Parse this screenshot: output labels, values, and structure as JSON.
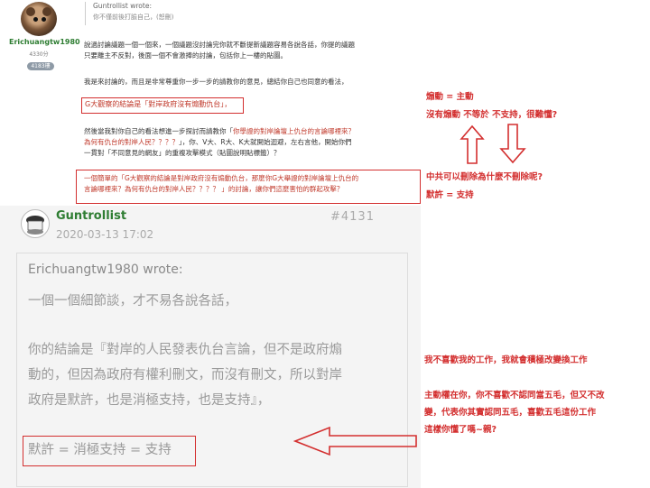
{
  "top_post": {
    "author": "Erichuangtw1980",
    "points": "4330分",
    "badge": "4183樓",
    "quote_author": "Guntrollist wrote:",
    "quote_text": "你不僅前後打臉自己，(恕刪)",
    "para1_line1": "說過討論議題一個一個來，一個議題沒討論完你就不斷提新議題容易各說各話，你提的議題",
    "para1_line2": "只要離主不反對，後面一個不會激捧的討論，包括你上一樓的貼圖。",
    "para2": "我是來討論的，而且是非常尊重你一步一步的請教你的意見，總結你自己也同意的看法，",
    "conclusion": "G大觀察的結論是「對岸政府沒有煽動仇台」，",
    "para3_line1_a": "然後當我對你自己的看法想進一步探討而請教你「",
    "para3_line1_b": "你學證的對岸論壇上仇台的言論哪裡來？",
    "para3_line2_a": "為何有仇台的對岸人民？？？？",
    "para3_line2_b": "」，你、V大、R大、K大就開始迴避，左右言他，開始你們",
    "para3_line3": "一貫對「不同意見的網友」的重複攻擊模式（貼圖說明貼標籤）？",
    "box_line1": "一個簡單的「G大觀察的結論是對岸政府沒有煽動仇台，那麼你G大舉證的對岸論壇上仇台的",
    "box_line2": "言論哪裡來？為何有仇台的對岸人民？？？？ 」的討論，讓你們這麼害怕的群起攻擊？"
  },
  "annotations": {
    "a1": "煽動 = 主動",
    "a2": "沒有煽動 不等於 不支持，很難懂?",
    "a3": "中共可以刪除為什麼不刪除呢?",
    "a4": "默許 = 支持",
    "a5": "我不喜歡我的工作，我就會積極改變換工作",
    "a6": "主動權在你，你不喜歡不認同當五毛，但又不改",
    "a7": "變，代表你其實認同五毛，喜歡五毛這份工作",
    "a8": "這樣你懂了嗎~親?"
  },
  "bottom_post": {
    "author": "Guntrollist",
    "post_number": "#4131",
    "date": "2020-03-13 17:02",
    "quote_author": "Erichuangtw1980 wrote:",
    "line1": "一個一個細節談，才不易各說各話，",
    "line2": "你的結論是『對岸的人民發表仇台言論，但不是政府煽",
    "line3": "動的，但因為政府有權利刪文，而沒有刪文，所以對岸",
    "line4": "政府是默許，也是消極支持，也是支持』，",
    "line5": "默許 = 消極支持 = 支持"
  },
  "colors": {
    "accent_red": "#d32f2f",
    "username_green": "#2e7d32"
  }
}
